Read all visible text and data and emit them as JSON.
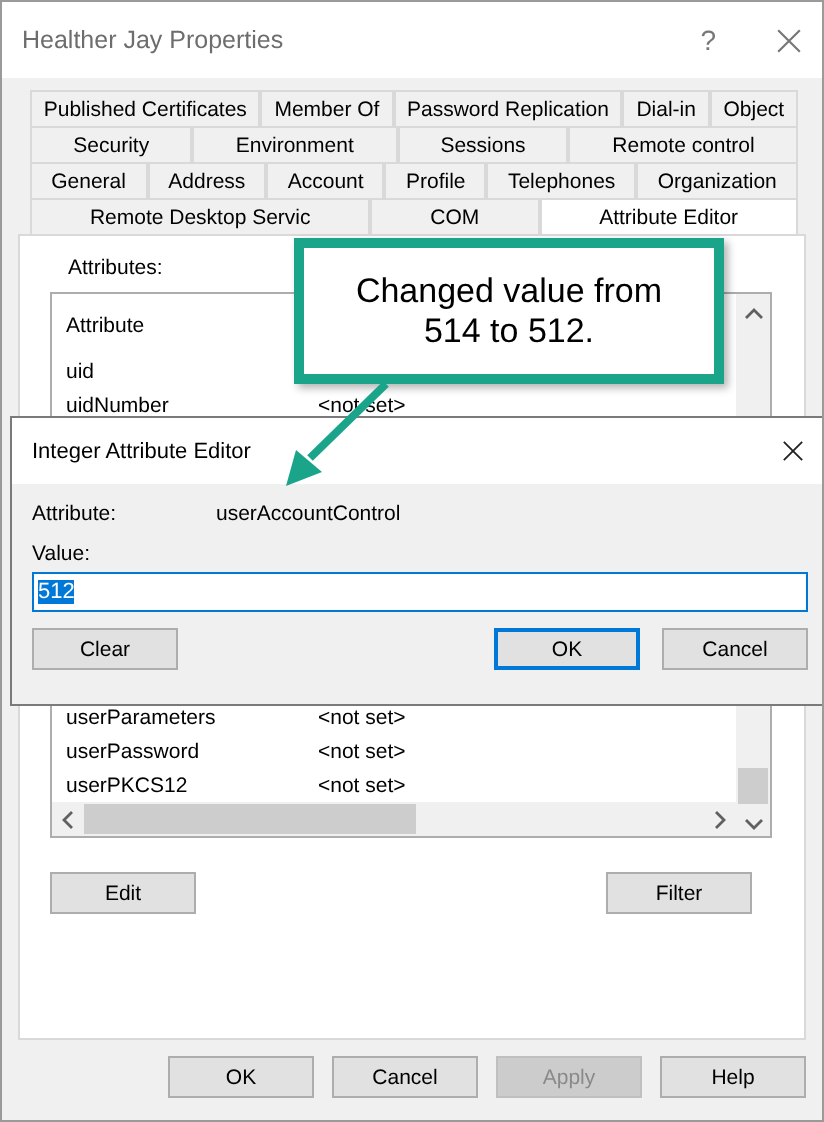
{
  "window": {
    "title": "Healther Jay Properties",
    "help": "?"
  },
  "tab_rows": [
    [
      {
        "label": "Published Certificates",
        "selected": false
      },
      {
        "label": "Member Of",
        "selected": false
      },
      {
        "label": "Password Replication",
        "selected": false
      },
      {
        "label": "Dial-in",
        "selected": false
      },
      {
        "label": "Object",
        "selected": false
      }
    ],
    [
      {
        "label": "Security",
        "selected": false
      },
      {
        "label": "Environment",
        "selected": false
      },
      {
        "label": "Sessions",
        "selected": false
      },
      {
        "label": "Remote control",
        "selected": false
      }
    ],
    [
      {
        "label": "General",
        "selected": false
      },
      {
        "label": "Address",
        "selected": false
      },
      {
        "label": "Account",
        "selected": false
      },
      {
        "label": "Profile",
        "selected": false
      },
      {
        "label": "Telephones",
        "selected": false
      },
      {
        "label": "Organization",
        "selected": false
      }
    ],
    [
      {
        "label": "Remote Desktop Servic",
        "selected": false
      },
      {
        "label": "COM",
        "selected": false
      },
      {
        "label": "Attribute Editor",
        "selected": true
      }
    ]
  ],
  "panel": {
    "attributes_label": "Attributes:",
    "list": {
      "header": "Attribute",
      "top_rows": [
        {
          "name": "uid"
        },
        {
          "name": "uidNumber",
          "value": "<not set>"
        }
      ],
      "bottom_rows": [
        {
          "name": "userParameters",
          "value": "<not set>"
        },
        {
          "name": "userPassword",
          "value": "<not set>"
        },
        {
          "name": "userPKCS12",
          "value": "<not set>"
        }
      ]
    },
    "buttons": [
      "Edit",
      "Filter"
    ]
  },
  "footer_buttons": [
    {
      "label": "OK",
      "disabled": false
    },
    {
      "label": "Cancel",
      "disabled": false
    },
    {
      "label": "Apply",
      "disabled": true
    },
    {
      "label": "Help",
      "disabled": false
    }
  ],
  "dialog": {
    "title": "Integer Attribute Editor",
    "attribute_label": "Attribute:",
    "attribute": "userAccountControl",
    "value_label": "Value:",
    "value": "512",
    "value_selected": true,
    "buttons": [
      {
        "label": "Clear",
        "default": false
      },
      {
        "label": "OK",
        "default": true
      },
      {
        "label": "Cancel",
        "default": false
      }
    ]
  },
  "callout": {
    "text": "Changed value from 514 to 512."
  }
}
